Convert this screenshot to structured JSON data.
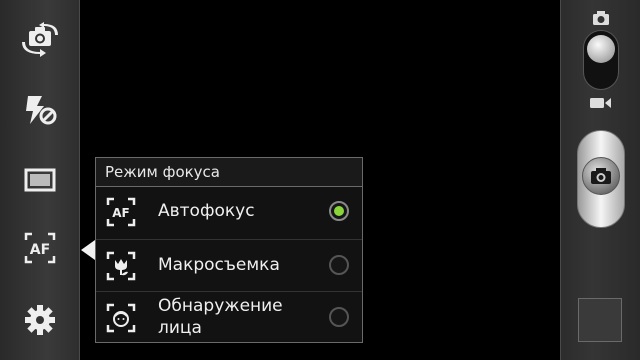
{
  "left_toolbar": {
    "items": [
      {
        "name": "switch-camera",
        "icon": "camera-switch-icon"
      },
      {
        "name": "flash",
        "icon": "flash-off-icon"
      },
      {
        "name": "resolution",
        "icon": "aspect-ratio-icon"
      },
      {
        "name": "focus-mode",
        "icon": "af-icon"
      },
      {
        "name": "settings",
        "icon": "gear-icon"
      }
    ]
  },
  "focus_popup": {
    "title": "Режим фокуса",
    "options": [
      {
        "label": "Автофокус",
        "icon": "af-icon",
        "selected": true
      },
      {
        "label": "Макросъемка",
        "icon": "macro-icon",
        "selected": false
      },
      {
        "label_line1": "Обнаружение",
        "label_line2": "лица",
        "icon": "face-detect-icon",
        "selected": false
      }
    ]
  },
  "right_panel": {
    "mode": "photo",
    "mode_icons": [
      "camera-icon",
      "video-icon"
    ]
  },
  "colors": {
    "accent_selected": "#8ad53a",
    "panel_bg": "#121212"
  }
}
